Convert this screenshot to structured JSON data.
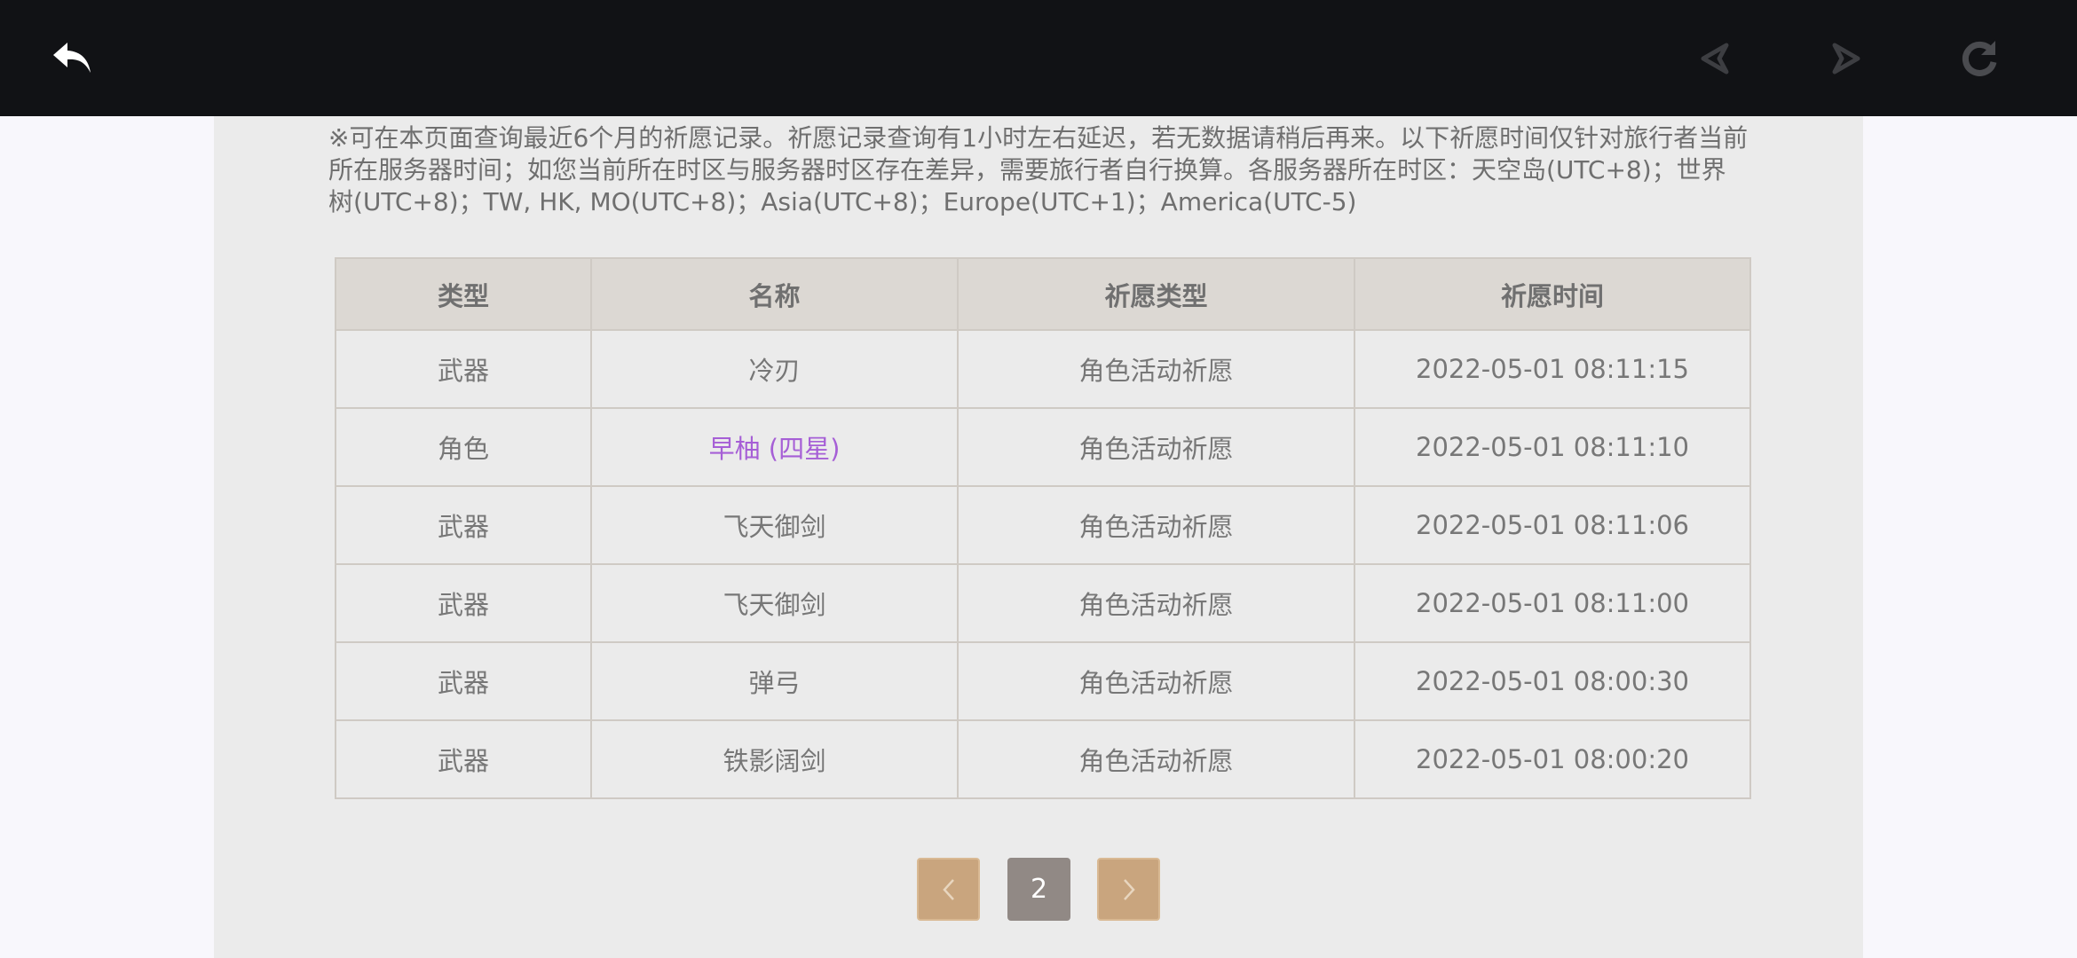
{
  "toolbar": {
    "back_icon": "back-arrow-icon",
    "prev_icon": "history-back-icon",
    "next_icon": "history-forward-icon",
    "refresh_icon": "refresh-icon"
  },
  "notice": {
    "text": "※可在本页面查询最近6个月的祈愿记录。祈愿记录查询有1小时左右延迟，若无数据请稍后再来。以下祈愿时间仅针对旅行者当前所在服务器时间；如您当前所在时区与服务器时区存在差异，需要旅行者自行换算。各服务器所在时区：天空岛(UTC+8)；世界树(UTC+8)；TW, HK, MO(UTC+8)；Asia(UTC+8)；Europe(UTC+1)；America(UTC-5)"
  },
  "table": {
    "headers": {
      "type": "类型",
      "name": "名称",
      "pool": "祈愿类型",
      "time": "祈愿时间"
    },
    "rows": [
      {
        "type": "武器",
        "name": "冷刃",
        "pool": "角色活动祈愿",
        "time": "2022-05-01 08:11:15"
      },
      {
        "type": "角色",
        "name": "早柚 (四星)",
        "pool": "角色活动祈愿",
        "time": "2022-05-01 08:11:10"
      },
      {
        "type": "武器",
        "name": "飞天御剑",
        "pool": "角色活动祈愿",
        "time": "2022-05-01 08:11:06"
      },
      {
        "type": "武器",
        "name": "飞天御剑",
        "pool": "角色活动祈愿",
        "time": "2022-05-01 08:11:00"
      },
      {
        "type": "武器",
        "name": "弹弓",
        "pool": "角色活动祈愿",
        "time": "2022-05-01 08:00:30"
      },
      {
        "type": "武器",
        "name": "铁影阔剑",
        "pool": "角色活动祈愿",
        "time": "2022-05-01 08:00:20"
      }
    ]
  },
  "pagination": {
    "prev_icon": "chevron-left-icon",
    "current_page": "2",
    "next_icon": "chevron-right-icon"
  },
  "colors": {
    "topbar": "#111215",
    "panel": "#ebebeb",
    "header_bg": "#dcd8d3",
    "four_star": "#a65fd6",
    "pager_gold": "#c9a57e",
    "pager_current": "#918985"
  }
}
